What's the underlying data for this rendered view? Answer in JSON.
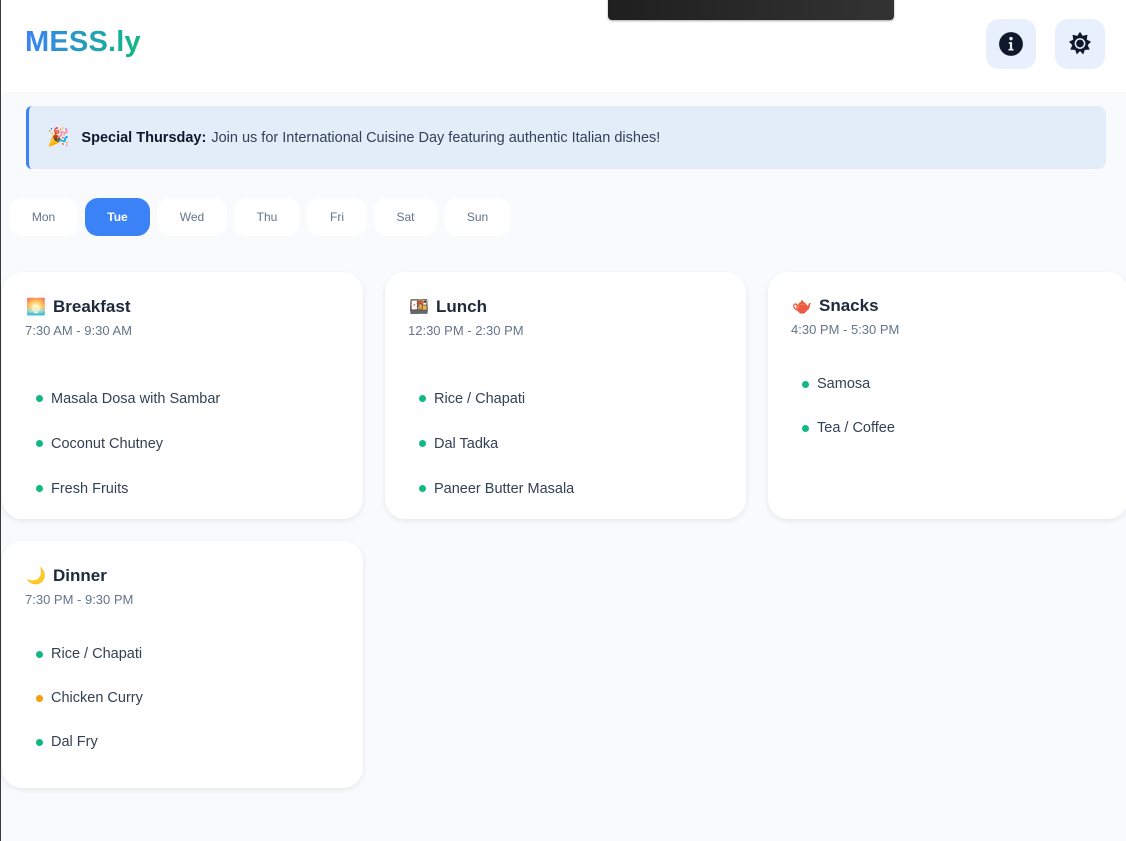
{
  "header": {
    "logo": "MESS.ly",
    "info_icon": "info-icon",
    "theme_icon": "sun-icon"
  },
  "banner": {
    "icon": "🎉",
    "title": "Special Thursday:",
    "message": "Join us for International Cuisine Day featuring authentic Italian dishes!"
  },
  "days": {
    "selected": "Tue",
    "items": [
      {
        "label": "Mon"
      },
      {
        "label": "Tue"
      },
      {
        "label": "Wed"
      },
      {
        "label": "Thu"
      },
      {
        "label": "Fri"
      },
      {
        "label": "Sat"
      },
      {
        "label": "Sun"
      }
    ]
  },
  "colors": {
    "accent": "#3b82f6",
    "veg": "#10b981",
    "non_veg": "#f59e0b"
  },
  "meals": [
    {
      "icon": "🌅",
      "name": "Breakfast",
      "time": "7:30 AM - 9:30 AM",
      "items": [
        {
          "name": "Masala Dosa with Sambar",
          "type": "veg"
        },
        {
          "name": "Coconut Chutney",
          "type": "veg"
        },
        {
          "name": "Fresh Fruits",
          "type": "veg"
        }
      ]
    },
    {
      "icon": "🍱",
      "name": "Lunch",
      "time": "12:30 PM - 2:30 PM",
      "items": [
        {
          "name": "Rice / Chapati",
          "type": "veg"
        },
        {
          "name": "Dal Tadka",
          "type": "veg"
        },
        {
          "name": "Paneer Butter Masala",
          "type": "veg"
        }
      ]
    },
    {
      "icon": "🫖",
      "name": "Snacks",
      "time": "4:30 PM - 5:30 PM",
      "items": [
        {
          "name": "Samosa",
          "type": "veg"
        },
        {
          "name": "Tea / Coffee",
          "type": "veg"
        }
      ]
    },
    {
      "icon": "🌙",
      "name": "Dinner",
      "time": "7:30 PM - 9:30 PM",
      "items": [
        {
          "name": "Rice / Chapati",
          "type": "veg"
        },
        {
          "name": "Chicken Curry",
          "type": "non_veg"
        },
        {
          "name": "Dal Fry",
          "type": "veg"
        }
      ]
    }
  ]
}
